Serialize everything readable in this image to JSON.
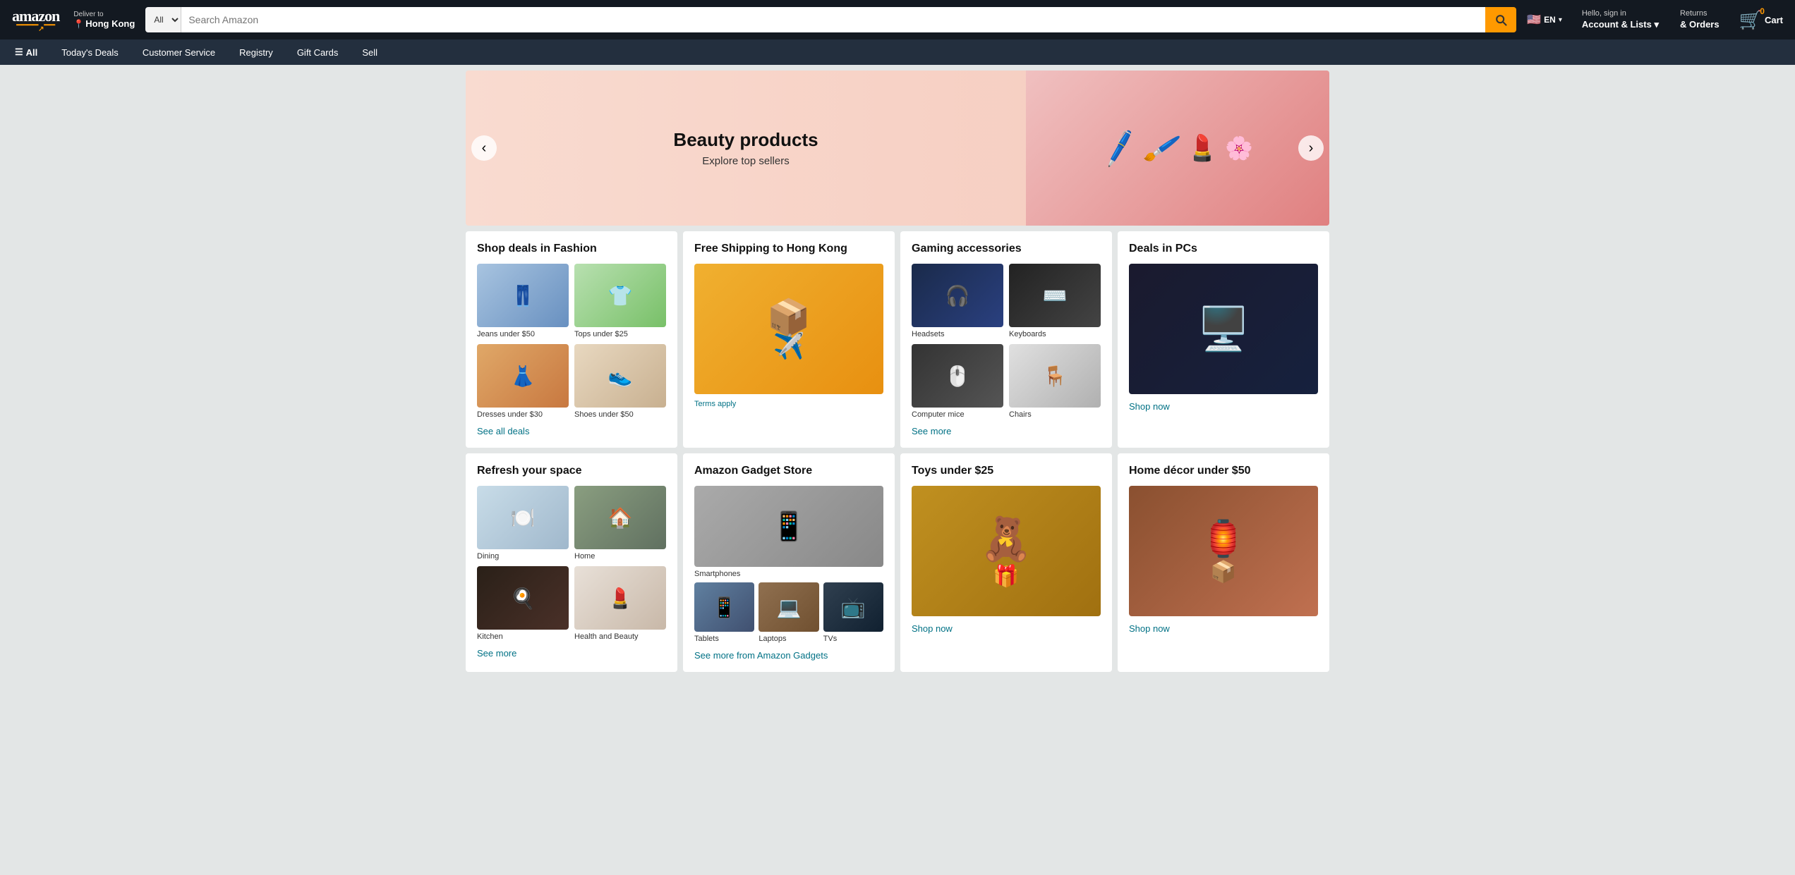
{
  "header": {
    "logo": "amazon",
    "logo_smile": "a",
    "deliver_label": "Deliver to",
    "deliver_location": "Hong Kong",
    "search_placeholder": "Search Amazon",
    "search_category": "All",
    "lang_flag": "🇺🇸",
    "lang_code": "EN",
    "sign_in_top": "Hello, sign in",
    "sign_in_bot": "Account & Lists",
    "returns_top": "Returns",
    "returns_bot": "& Orders",
    "cart_label": "Cart",
    "cart_count": "0"
  },
  "navbar": {
    "all_label": "All",
    "items": [
      "Today's Deals",
      "Customer Service",
      "Registry",
      "Gift Cards",
      "Sell"
    ]
  },
  "hero": {
    "title": "Beauty products",
    "subtitle": "Explore top sellers",
    "nav_left": "‹",
    "nav_right": "›"
  },
  "cards": {
    "fashion": {
      "title": "Shop deals in Fashion",
      "items": [
        {
          "label": "Jeans under $50",
          "emoji": "👖"
        },
        {
          "label": "Tops under $25",
          "emoji": "👕"
        },
        {
          "label": "Dresses under $30",
          "emoji": "👗"
        },
        {
          "label": "Shoes under $50",
          "emoji": "👟"
        }
      ],
      "link": "See all deals"
    },
    "shipping": {
      "title": "Free Shipping to Hong Kong",
      "emoji": "📦✈️",
      "terms": "Terms apply"
    },
    "gaming": {
      "title": "Gaming accessories",
      "items": [
        {
          "label": "Headsets",
          "emoji": "🎧"
        },
        {
          "label": "Keyboards",
          "emoji": "⌨️"
        },
        {
          "label": "Computer mice",
          "emoji": "🖱️"
        },
        {
          "label": "Chairs",
          "emoji": "🪑"
        }
      ],
      "link": "See more"
    },
    "pcs": {
      "title": "Deals in PCs",
      "emoji": "🖥️",
      "link": "Shop now"
    },
    "space": {
      "title": "Refresh your space",
      "items": [
        {
          "label": "Dining",
          "emoji": "🍽️"
        },
        {
          "label": "Home",
          "emoji": "🏠"
        },
        {
          "label": "Kitchen",
          "emoji": "🍳"
        },
        {
          "label": "Health and Beauty",
          "emoji": "💄"
        }
      ],
      "link": "See more"
    },
    "gadgets": {
      "title": "Amazon Gadget Store",
      "top_label": "Smartphones",
      "top_emoji": "📱",
      "subitems": [
        {
          "label": "Tablets",
          "emoji": "📱"
        },
        {
          "label": "Laptops",
          "emoji": "💻"
        },
        {
          "label": "TVs",
          "emoji": "📺"
        }
      ],
      "link": "See more from Amazon Gadgets"
    },
    "toys": {
      "title": "Toys under $25",
      "emoji": "🧸",
      "link": "Shop now"
    },
    "decor": {
      "title": "Home décor under $50",
      "emoji": "🏮",
      "link": "Shop now"
    }
  }
}
